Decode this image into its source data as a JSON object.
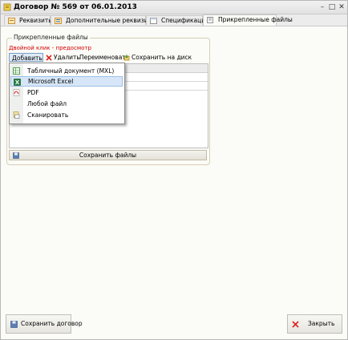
{
  "window": {
    "title": "Договор № 569 от 06.01.2013"
  },
  "tabs": [
    {
      "label": "Реквизиты"
    },
    {
      "label": "Дополнительные реквизиты"
    },
    {
      "label": "Спецификация"
    },
    {
      "label": "Прикрепленные файлы"
    }
  ],
  "files_group": {
    "title": "Прикрепленные файлы",
    "hint": "Двойной клик - предосмотр"
  },
  "toolbar": {
    "add_label": "Добавить",
    "delete_label": "Удалить",
    "rename_label": "Переименовать",
    "save_to_disk_label": "Сохранить на диск"
  },
  "add_menu": {
    "items": [
      {
        "label": "Табличный документ (MXL)",
        "icon": "spreadsheet-icon"
      },
      {
        "label": "Microsoft Excel",
        "icon": "excel-icon"
      },
      {
        "label": "PDF",
        "icon": "pdf-icon"
      },
      {
        "label": "Любой файл",
        "icon": "file-icon"
      },
      {
        "label": "Сканировать",
        "icon": "scanner-icon"
      }
    ],
    "highlighted_index": 1
  },
  "buttons": {
    "save_files": "Сохранить файлы",
    "save_contract": "Сохранить договор",
    "close": "Закрыть"
  },
  "colors": {
    "hint_red": "#d30000",
    "menu_highlight": "#d6e6f8",
    "accent_blue": "#7a9ec7"
  }
}
